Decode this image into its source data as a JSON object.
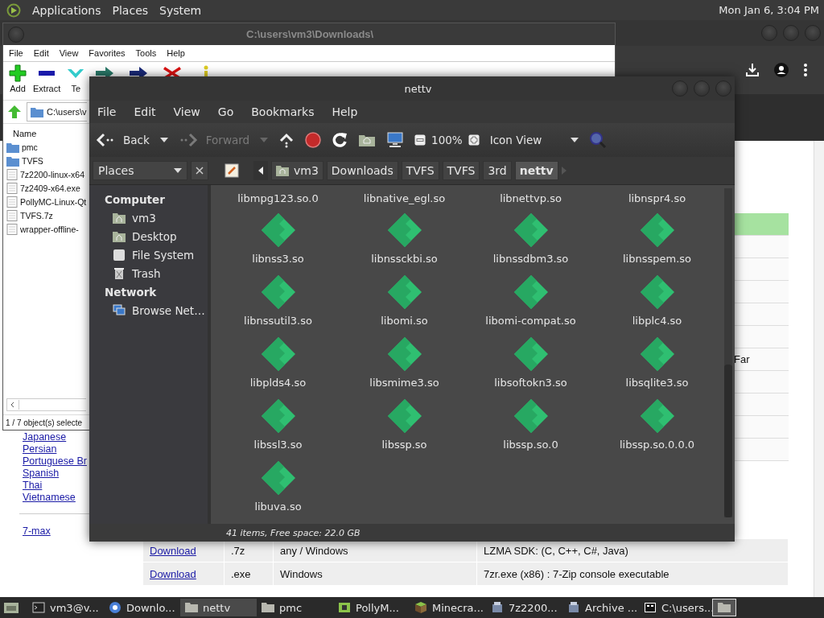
{
  "top_panel": {
    "menus": [
      "Applications",
      "Places",
      "System"
    ],
    "clock": "Mon Jan 6, 3:04 PM"
  },
  "browser": {
    "languages": [
      "Japanese",
      "Persian",
      "Portuguese Br",
      "Spanish",
      "Thai",
      "Vietnamese"
    ],
    "side_link": "7-max",
    "covered_rows": [
      {
        "highlighted": true
      },
      {
        "highlighted": false
      },
      {
        "highlighted": false
      },
      {
        "highlighted": false
      },
      {
        "highlighted": false
      },
      {
        "highlighted": false
      },
      {
        "highlighted": false,
        "text": "Far"
      },
      {
        "highlighted": false
      },
      {
        "highlighted": false
      },
      {
        "highlighted": false
      },
      {
        "highlighted": false
      }
    ],
    "rows": [
      {
        "link": "Download",
        "ext": ".7z",
        "os": "any / Windows",
        "description": "LZMA SDK: (C, C++, C#, Java)"
      },
      {
        "link": "Download",
        "ext": ".exe",
        "os": "Windows",
        "description": "7zr.exe (x86) : 7-Zip console executable"
      }
    ]
  },
  "archive_window": {
    "title": "C:\\users\\vm3\\Downloads\\",
    "menu": [
      "File",
      "Edit",
      "View",
      "Favorites",
      "Tools",
      "Help"
    ],
    "tools": [
      {
        "kind": "add",
        "label": "Add"
      },
      {
        "kind": "extract",
        "label": "Extract"
      },
      {
        "kind": "test",
        "label": "Te"
      },
      {
        "kind": "copy"
      },
      {
        "kind": "move"
      },
      {
        "kind": "delete"
      },
      {
        "kind": "info"
      }
    ],
    "path": "C:\\users\\v",
    "column": "Name",
    "files": [
      {
        "name": "pmc",
        "kind": "folder"
      },
      {
        "name": "TVFS",
        "kind": "folder"
      },
      {
        "name": "7z2200-linux-x64",
        "kind": "file"
      },
      {
        "name": "7z2409-x64.exe",
        "kind": "file"
      },
      {
        "name": "PollyMC-Linux-Qt",
        "kind": "file"
      },
      {
        "name": "TVFS.7z",
        "kind": "file"
      },
      {
        "name": "wrapper-offline-",
        "kind": "file"
      }
    ],
    "status": "1 / 7 object(s) selecte"
  },
  "file_manager": {
    "title": "nettv",
    "menu": [
      "File",
      "Edit",
      "View",
      "Go",
      "Bookmarks",
      "Help"
    ],
    "toolbar": {
      "back": "Back",
      "forward": "Forward",
      "forward_disabled": true,
      "zoom": "100%",
      "view": "Icon View"
    },
    "places_label": "Places",
    "breadcrumbs": [
      {
        "label": "vm3",
        "kind": "home",
        "selected": false
      },
      {
        "label": "Downloads",
        "kind": "folder",
        "selected": false
      },
      {
        "label": "TVFS",
        "kind": "folder",
        "selected": false
      },
      {
        "label": "TVFS",
        "kind": "folder",
        "selected": false
      },
      {
        "label": "3rd",
        "kind": "folder",
        "selected": false
      },
      {
        "label": "nettv",
        "kind": "folder",
        "selected": true
      }
    ],
    "sidebar": [
      {
        "heading": "Computer",
        "items": [
          {
            "label": "vm3",
            "kind": "home"
          },
          {
            "label": "Desktop",
            "kind": "desktop"
          },
          {
            "label": "File System",
            "kind": "drive"
          },
          {
            "label": "Trash",
            "kind": "trash"
          }
        ]
      },
      {
        "heading": "Network",
        "items": [
          {
            "label": "Browse Net…",
            "kind": "network"
          }
        ]
      }
    ],
    "files": [
      {
        "name": "libmpg123.so.0",
        "kind": "partial"
      },
      {
        "name": "libnative_egl.so",
        "kind": "partial"
      },
      {
        "name": "libnettvp.so",
        "kind": "partial"
      },
      {
        "name": "libnspr4.so",
        "kind": "partial"
      },
      {
        "name": "libnss3.so",
        "kind": "library"
      },
      {
        "name": "libnssckbi.so",
        "kind": "library"
      },
      {
        "name": "libnssdbm3.so",
        "kind": "library"
      },
      {
        "name": "libnsspem.so",
        "kind": "library"
      },
      {
        "name": "libnssutil3.so",
        "kind": "library"
      },
      {
        "name": "libomi.so",
        "kind": "library"
      },
      {
        "name": "libomi-compat.so",
        "kind": "library"
      },
      {
        "name": "libplc4.so",
        "kind": "library"
      },
      {
        "name": "libplds4.so",
        "kind": "library"
      },
      {
        "name": "libsmime3.so",
        "kind": "library"
      },
      {
        "name": "libsoftokn3.so",
        "kind": "library"
      },
      {
        "name": "libsqlite3.so",
        "kind": "library"
      },
      {
        "name": "libssl3.so",
        "kind": "library"
      },
      {
        "name": "libssp.so",
        "kind": "library"
      },
      {
        "name": "libssp.so.0",
        "kind": "library"
      },
      {
        "name": "libssp.so.0.0.0",
        "kind": "library"
      },
      {
        "name": "libuva.so",
        "kind": "library"
      }
    ],
    "status": "41 items, Free space: 22.0 GB"
  },
  "taskbar": [
    {
      "label": "vm3@v...",
      "kind": "terminal",
      "selected": false
    },
    {
      "label": "Downlo...",
      "kind": "browser",
      "selected": false
    },
    {
      "label": "nettv",
      "kind": "folder",
      "selected": true
    },
    {
      "label": "pmc",
      "kind": "folder",
      "selected": false
    },
    {
      "label": "PollyM...",
      "kind": "launcher",
      "selected": false
    },
    {
      "label": "Minecra...",
      "kind": "cube",
      "selected": false
    },
    {
      "label": "7z2200...",
      "kind": "package",
      "selected": false
    },
    {
      "label": "Archive ...",
      "kind": "package",
      "selected": false
    },
    {
      "label": "C:\\users...",
      "kind": "sevenzip",
      "selected": false
    }
  ]
}
